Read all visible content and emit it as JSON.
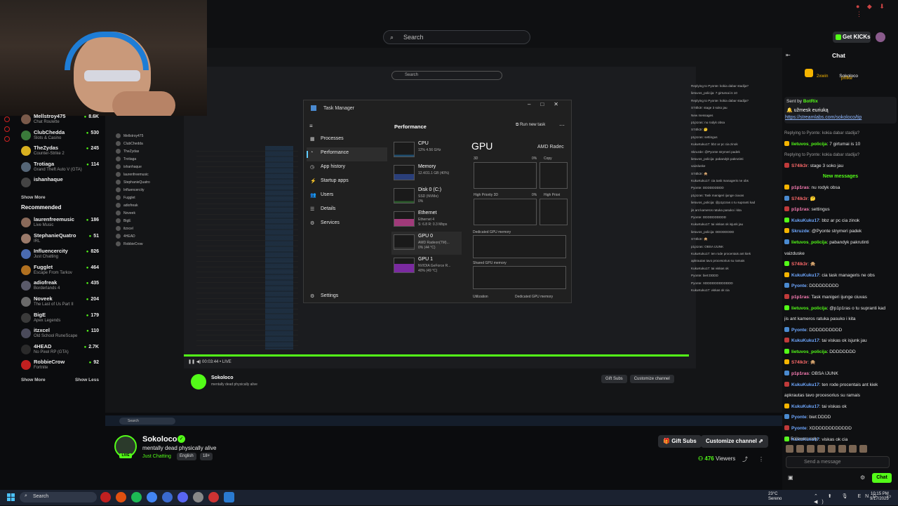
{
  "browser": {
    "search_placeholder": "Search",
    "get_kicks": "Get KICKs"
  },
  "sidebar": {
    "following": [
      {
        "name": "Mellstroy475",
        "category": "Chat Roulette",
        "viewers": "8.6K",
        "color": "#7a5a4a"
      },
      {
        "name": "ClubChedda",
        "category": "Slots & Casino",
        "viewers": "530",
        "color": "#3a7a3a"
      },
      {
        "name": "TheZydas",
        "category": "Counter-Strike 2",
        "viewers": "245",
        "color": "#d8b020"
      },
      {
        "name": "Trotiaga",
        "category": "Grand Theft Auto V (GTA)",
        "viewers": "114",
        "color": "#556677"
      },
      {
        "name": "ishanhaque",
        "category": "",
        "viewers": "",
        "color": "#444"
      }
    ],
    "show_more": "Show More",
    "recommended_title": "Recommended",
    "recommended": [
      {
        "name": "laurenfreemusic",
        "category": "Live Music",
        "viewers": "186",
        "color": "#8a6a5a"
      },
      {
        "name": "StephanieQuatro",
        "category": "IRL",
        "viewers": "51",
        "color": "#9a7a6a"
      },
      {
        "name": "Influencercity",
        "category": "Just Chatting",
        "viewers": "826",
        "color": "#4a6ab0"
      },
      {
        "name": "Fugglet",
        "category": "Escape From Tarkov",
        "viewers": "464",
        "color": "#b07020"
      },
      {
        "name": "adiofreak",
        "category": "Borderlands 4",
        "viewers": "435",
        "color": "#5a5a6a"
      },
      {
        "name": "Noveek",
        "category": "The Last of Us Part II",
        "viewers": "204",
        "color": "#6a6a6a"
      },
      {
        "name": "BigE",
        "category": "Apex Legends",
        "viewers": "179",
        "color": "#3a3a3a"
      },
      {
        "name": "itzxcel",
        "category": "Old School RuneScape",
        "viewers": "110",
        "color": "#4a4a5a"
      },
      {
        "name": "4HEAD",
        "category": "No Pixel RP (GTA)",
        "viewers": "2.7K",
        "color": "#2a2a2a"
      },
      {
        "name": "RobbieCrow",
        "category": "Fortnite",
        "viewers": "92",
        "color": "#c02020"
      }
    ],
    "show_more_bottom": "Show More",
    "show_less": "Show Less"
  },
  "task_manager": {
    "title": "Task Manager",
    "nav": [
      "Processes",
      "Performance",
      "App history",
      "Startup apps",
      "Users",
      "Details",
      "Services"
    ],
    "settings": "Settings",
    "section": "Performance",
    "run_new_task": "Run new task",
    "resources": [
      {
        "name": "CPU",
        "d1": "12%  4.56 GHz",
        "d2": ""
      },
      {
        "name": "Memory",
        "d1": "12.4/31.1 GB (40%)",
        "d2": ""
      },
      {
        "name": "Disk 0 (C:)",
        "d1": "SSD (NVMe)",
        "d2": "0%"
      },
      {
        "name": "Ethernet",
        "d1": "Ethernet 4",
        "d2": "S: 6.8  R: 0.3 Mbps"
      },
      {
        "name": "GPU 0",
        "d1": "AMD Radeon(TM)...",
        "d2": "0% (44 °C)"
      },
      {
        "name": "GPU 1",
        "d1": "NVIDIA GeForce R...",
        "d2": "40% (49 °C)"
      }
    ],
    "gpu_heading": "GPU",
    "gpu_name": "AMD Radec",
    "graph_labels": {
      "g3d": "3D",
      "g3d_pct": "0%",
      "copy": "Copy",
      "hp3d": "High Priority 3D",
      "hp3d_pct": "0%",
      "hpc": "High Priori",
      "dedicated": "Dedicated GPU memory",
      "shared": "Shared GPU memory",
      "util": "Utilization",
      "dedicated2": "Dedicated GPU memory"
    }
  },
  "stream": {
    "streamer": "Sokoloco",
    "title": "mentally dead physically alive",
    "category": "Just Chatting",
    "tags": [
      "English",
      "18+"
    ],
    "live": "LIVE",
    "gift_subs": "Gift Subs",
    "customize": "Customize channel",
    "viewers": "476",
    "viewers_label": "Viewers",
    "player_time": "00:03:44 • LIVE"
  },
  "chat": {
    "title": "Chat",
    "subgoal_user": "2xwin",
    "subgoal_user2": "Sokoloco",
    "subgoal_user3": "prifke",
    "pinned_by_label": "Sent by",
    "pinned_by": "BotRix",
    "pinned_msg": "užmesk euriuką",
    "pinned_link": "https://streamlabs.com/sokoloco/tip",
    "messages": [
      {
        "reply": "Replying to Pyonte: kokia dabar stadija?",
        "user": "",
        "text": "",
        "color": "#999"
      },
      {
        "reply": "",
        "user": "lietuvos_policija",
        "text": ": 7 girtumai is 10",
        "color": "#53fc18"
      },
      {
        "reply": "Replying to Pyonte: kokia dabar stadija?",
        "user": "",
        "text": "",
        "color": "#999"
      },
      {
        "reply": "",
        "user": "S74lk3r",
        "text": ": stage 3 soko jau",
        "color": "#ff6b6b"
      },
      {
        "divider": "New messages"
      },
      {
        "reply": "",
        "user": "p1p1ras",
        "text": ": nu rodyk obsa",
        "color": "#ff7fb8"
      },
      {
        "reply": "",
        "user": "S74lk3r",
        "text": ": 🤔",
        "color": "#ff6b6b"
      },
      {
        "reply": "",
        "user": "p1p1ras",
        "text": ": settingus",
        "color": "#ff7fb8"
      },
      {
        "reply": "",
        "user": "KukuKuku17",
        "text": ": bbz ar pc cia zinok",
        "color": "#6fa8ff"
      },
      {
        "reply": "",
        "user": "Skruzde",
        "text": ": @Pyonte strymeri padek",
        "color": "#6fa8ff"
      },
      {
        "reply": "",
        "user": "lietuvos_policija",
        "text": ": pabandyk pakrutinti",
        "color": "#53fc18"
      },
      {
        "reply": "",
        "user": "",
        "text": "vaizduske",
        "color": "#eee"
      },
      {
        "reply": "",
        "user": "S74lk3r",
        "text": ": 🙊",
        "color": "#ff6b6b"
      },
      {
        "reply": "",
        "user": "KukuKuku17",
        "text": ": cia task manageris ne obs",
        "color": "#6fa8ff"
      },
      {
        "reply": "",
        "user": "Pyonte",
        "text": ": DDDDDDDDD",
        "color": "#6fa8ff"
      },
      {
        "reply": "",
        "user": "p1p1ras",
        "text": ": Task manigeri ijunge ciuvas",
        "color": "#ff7fb8"
      },
      {
        "reply": "",
        "user": "lietuvos_policija",
        "text": ": @p1p1ras o tu supranti kad",
        "color": "#53fc18"
      },
      {
        "reply": "",
        "user": "",
        "text": "jis ant kameros ratuka pasuko i kita",
        "color": "#eee"
      },
      {
        "reply": "",
        "user": "Pyonte",
        "text": ": DDDDDDDDDD",
        "color": "#6fa8ff"
      },
      {
        "reply": "",
        "user": "KukuKuku17",
        "text": ": tai viskas ok isjunk jau",
        "color": "#6fa8ff"
      },
      {
        "reply": "",
        "user": "lietuvos_policija",
        "text": ": DDDDDDDD",
        "color": "#53fc18"
      },
      {
        "reply": "",
        "user": "S74lk3r",
        "text": ": 🙊",
        "color": "#ff6b6b"
      },
      {
        "reply": "",
        "user": "p1p1ras",
        "text": ": OBSA IJUNK",
        "color": "#ff7fb8"
      },
      {
        "reply": "",
        "user": "KukuKuku17",
        "text": ": ten rode procentais ant kiek",
        "color": "#6fa8ff"
      },
      {
        "reply": "",
        "user": "",
        "text": "apkrautas tavo procesorius su ramais",
        "color": "#eee"
      },
      {
        "reply": "",
        "user": "KukuKuku17",
        "text": ": tai viskas ok",
        "color": "#6fa8ff"
      },
      {
        "reply": "",
        "user": "Pyonte",
        "text": ": biet:DDDD",
        "color": "#6fa8ff"
      },
      {
        "reply": "",
        "user": "Pyonte",
        "text": ": XDDDDDDDDDDDD",
        "color": "#6fa8ff"
      },
      {
        "reply": "",
        "user": "KukuKuku17",
        "text": ": viskas ok cia",
        "color": "#6fa8ff"
      }
    ],
    "followers_only": "Followers only",
    "input_placeholder": "Send a message",
    "send": "Chat"
  },
  "taskbar": {
    "search": "Search",
    "weather_temp": "23°C",
    "weather_desc": "Serenо",
    "lang": "ENG",
    "time": "10:15 PM",
    "date": "9/17/2025"
  }
}
